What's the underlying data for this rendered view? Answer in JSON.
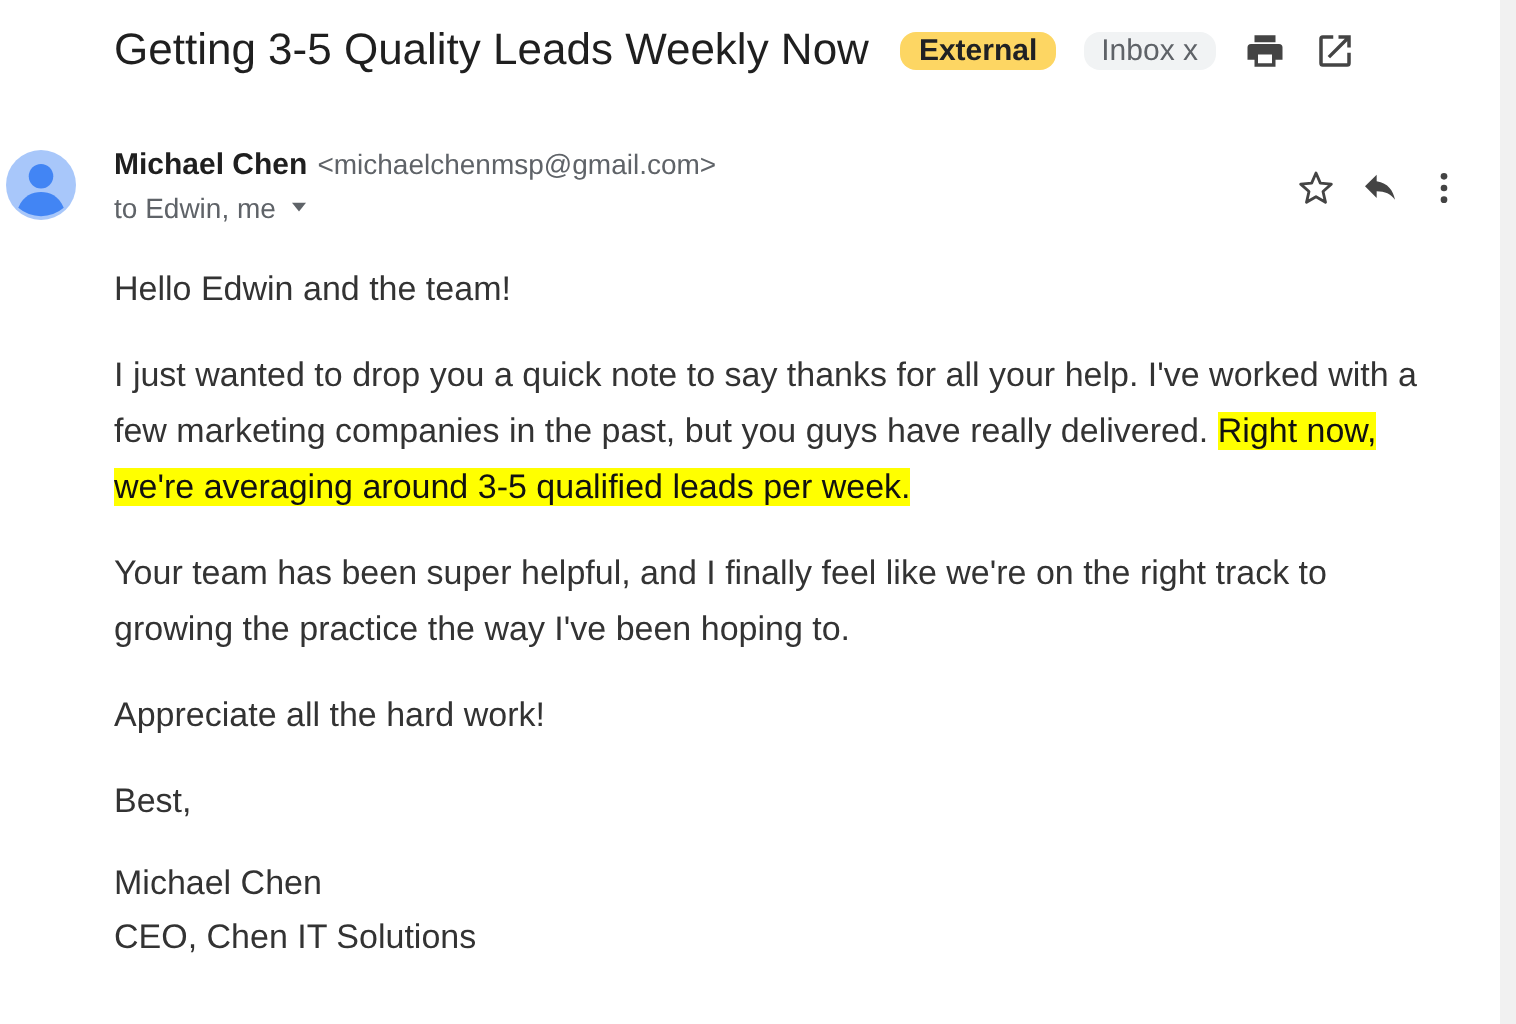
{
  "subject": "Getting 3-5 Quality Leads Weekly Now",
  "labels": [
    {
      "text": "External",
      "kind": "external"
    },
    {
      "text": "Inbox x",
      "kind": "folder"
    }
  ],
  "sender": {
    "name": "Michael Chen",
    "email": "<michaelchenmsp@gmail.com>",
    "recipients": "to Edwin, me"
  },
  "body": [
    [
      {
        "text": "Hello Edwin and the team!",
        "highlighted": false
      }
    ],
    [
      {
        "text": "I just wanted to drop you a quick note to say thanks for all your help. I've worked with a few marketing companies in the past, but you guys have really delivered. ",
        "highlighted": false
      },
      {
        "text": "Right now, we're averaging around 3-5 qualified leads per week.",
        "highlighted": true
      }
    ],
    [
      {
        "text": "Your team has been super helpful, and I finally feel like we're on the right track to growing the practice the way I've been hoping to.",
        "highlighted": false
      }
    ],
    [
      {
        "text": "Appreciate all the hard work!",
        "highlighted": false
      }
    ],
    [
      {
        "text": "Best,",
        "highlighted": false
      }
    ]
  ],
  "signature": [
    "Michael Chen",
    "CEO, Chen IT Solutions"
  ]
}
